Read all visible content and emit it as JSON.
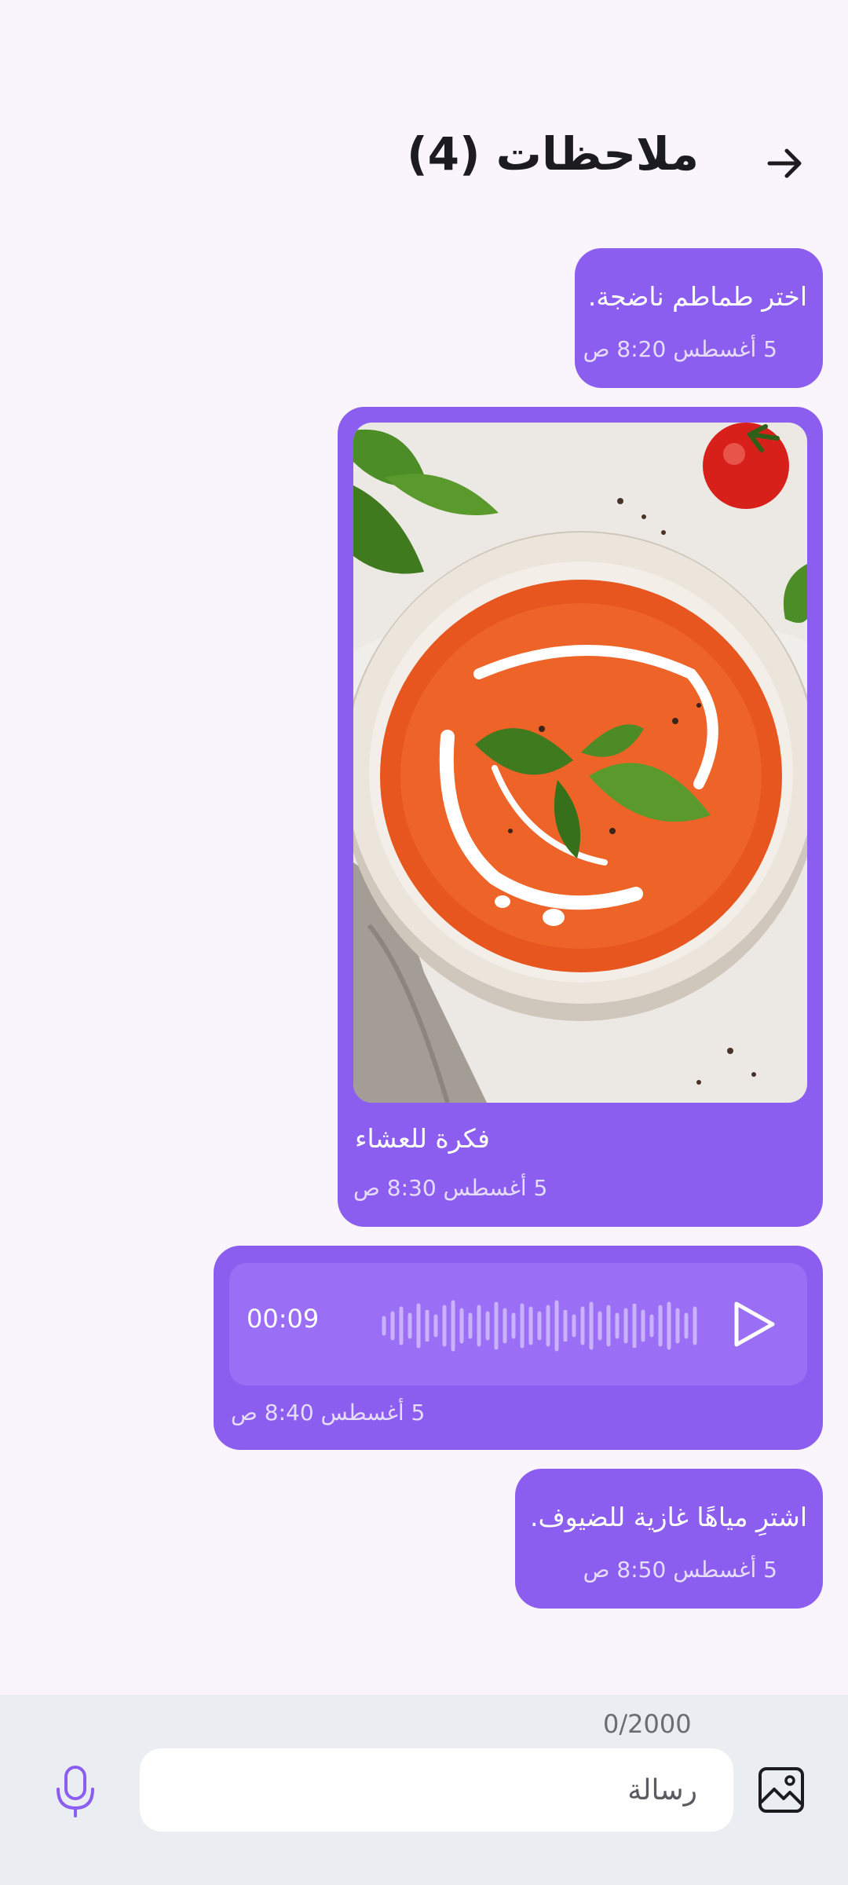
{
  "header": {
    "title": "ملاحظات (4)"
  },
  "messages": [
    {
      "type": "text",
      "text": "اختر طماطم ناضجة.",
      "time": "5 أغسطس 8:20 ص"
    },
    {
      "type": "image",
      "image_icon": "tomato-soup-photo",
      "caption": "فكرة للعشاء",
      "time": "5 أغسطس 8:30 ص"
    },
    {
      "type": "audio",
      "duration": "00:09",
      "time": "5 أغسطس 8:40 ص"
    },
    {
      "type": "text",
      "text": "اشترِ مياهًا غازية للضيوف.",
      "time": "5 أغسطس 8:50 ص"
    }
  ],
  "composer": {
    "counter": "0/2000",
    "placeholder": "رسالة"
  },
  "colors": {
    "background": "#faf4fd",
    "bubble": "#8c5ef0",
    "composer": "#eaedf2",
    "accent": "#8c5ef0"
  }
}
